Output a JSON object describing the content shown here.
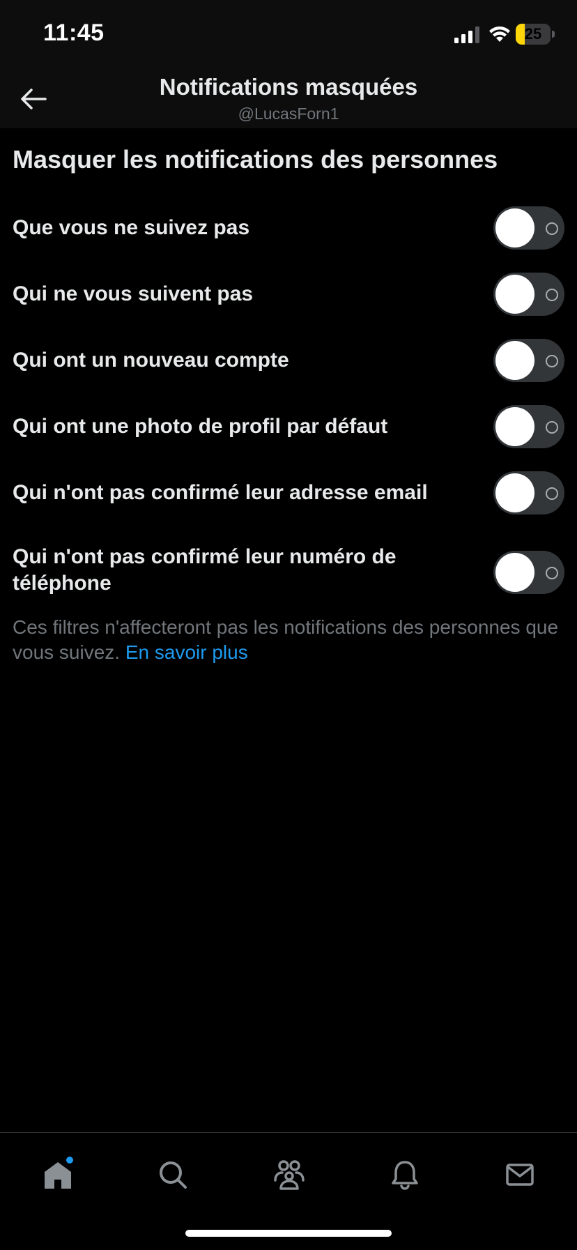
{
  "status_bar": {
    "time": "11:45",
    "battery_level": "25",
    "battery_fraction": 0.25,
    "battery_color": "#ffd60a"
  },
  "header": {
    "title": "Notifications masquées",
    "subtitle": "@LucasForn1",
    "back_icon": "arrow-left-icon"
  },
  "main": {
    "section_title": "Masquer les notifications des personnes",
    "settings": [
      {
        "label": "Que vous ne suivez pas",
        "enabled": false
      },
      {
        "label": "Qui ne vous suivent pas",
        "enabled": false
      },
      {
        "label": "Qui ont un nouveau compte",
        "enabled": false
      },
      {
        "label": "Qui ont une photo de profil par défaut",
        "enabled": false
      },
      {
        "label": "Qui n'ont pas confirmé leur adresse email",
        "enabled": false
      },
      {
        "label": "Qui n'ont pas confirmé leur numéro de téléphone",
        "enabled": false
      }
    ],
    "footnote": "Ces filtres n'affecteront pas les notifications des personnes que vous suivez. ",
    "footnote_link": "En savoir plus"
  },
  "bottom_nav": {
    "items": [
      {
        "name": "home",
        "icon": "home-icon",
        "has_badge": true
      },
      {
        "name": "search",
        "icon": "search-icon"
      },
      {
        "name": "communities",
        "icon": "people-icon"
      },
      {
        "name": "notifications",
        "icon": "bell-icon"
      },
      {
        "name": "messages",
        "icon": "mail-icon"
      }
    ]
  },
  "colors": {
    "background": "#000000",
    "bar_background": "#0d0d0d",
    "text_primary": "#e7e9ea",
    "text_secondary": "#71767b",
    "accent": "#1d9bf0",
    "toggle_track": "#333639"
  }
}
